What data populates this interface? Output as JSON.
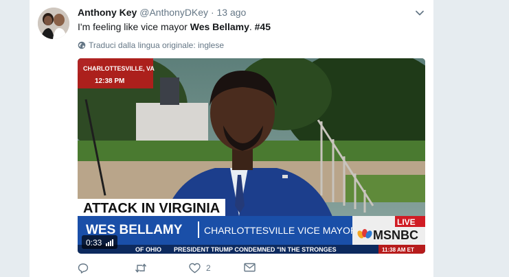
{
  "tweet": {
    "author_name": "Anthony Key",
    "author_handle": "@AnthonyDKey",
    "separator": "·",
    "time_ago": "13 ago",
    "text_plain": "I'm feeling like vice mayor ",
    "text_bold_name": "Wes Bellamy",
    "text_after_name": ". ",
    "hashtag": "#45",
    "translate_label": "Traduci dalla lingua originale: inglese"
  },
  "video": {
    "location_bug": "CHARLOTTESVILLE, VA",
    "time_bug": "12:38 PM",
    "headline": "ATTACK IN VIRGINIA",
    "lower_third_name": "WES BELLAMY",
    "lower_third_title": "CHARLOTTESVILLE VICE MAYOR",
    "live_label": "LIVE",
    "network": "MSNBC",
    "ticker_left": "OF OHIO",
    "ticker_text": "PRESIDENT TRUMP CONDEMNED \"IN THE STRONGES",
    "ticker_right": "11:38 AM ET",
    "duration": "0:33"
  },
  "actions": {
    "reply_icon": "reply-icon",
    "retweet_icon": "retweet-icon",
    "like_icon": "heart-icon",
    "like_count": "2",
    "dm_icon": "envelope-icon"
  },
  "colors": {
    "msnbc_blue": "#1a4fa8",
    "live_red": "#d01c24",
    "text_secondary": "#657786"
  }
}
